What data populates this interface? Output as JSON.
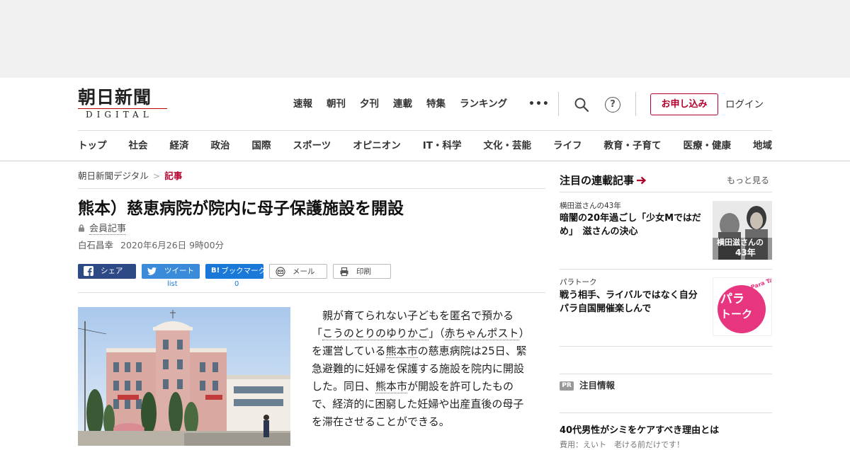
{
  "logo": {
    "kanji": "朝日新聞",
    "digital": "DIGITAL"
  },
  "top_nav": [
    "速報",
    "朝刊",
    "夕刊",
    "連載",
    "特集",
    "ランキング"
  ],
  "more_label": "•••",
  "header_actions": {
    "help": "?",
    "apply": "お申し込み",
    "login": "ログイン"
  },
  "categories": [
    "トップ",
    "社会",
    "経済",
    "政治",
    "国際",
    "スポーツ",
    "オピニオン",
    "IT・科学",
    "文化・芸能",
    "ライフ",
    "教育・子育て",
    "医療・健康",
    "地域"
  ],
  "breadcrumb": {
    "home": "朝日新聞デジタル",
    "sep": ">",
    "current": "記事"
  },
  "article": {
    "title": "熊本）慈恵病院が院内に母子保護施設を開設",
    "member_label": "会員記事",
    "author": "白石昌幸",
    "date": "2020年6月26日 9時00分",
    "body": {
      "p1": "　親が育てられない子どもを匿名で預かる「",
      "link1": "こうのとりのゆりかご",
      "p2": "」（",
      "link2": "赤ちゃんポスト",
      "p3": "）を運営している",
      "link3": "熊本市",
      "p4": "の慈恵病院は25日、緊急避難的に妊婦を保護する施設を院内に開設した。同日、",
      "link4": "熊本市",
      "p5": "が開設を許可したもので、経済的に困窮した妊婦や出産直後の母子を滞在させることができる。"
    }
  },
  "share": {
    "facebook": "シェア",
    "twitter": "ツイート",
    "twitter_count": "list",
    "hatena_icon": "B!",
    "hatena": "ブックマーク",
    "hatena_count": "0",
    "mail": "メール",
    "print": "印刷"
  },
  "sidebar": {
    "heading": "注目の連載記事",
    "more": "もっと見る",
    "items": [
      {
        "kicker": "横田滋さんの43年",
        "title": "暗闇の20年過ごし「少女Mではだめ」　滋さんの決心",
        "thumb_text": "横田滋さんの",
        "thumb_num": "43年"
      },
      {
        "kicker": "パラトーク",
        "title": "戦う相手、ライバルではなく自分　パラ自国開催楽しんで",
        "thumb_text_1": "パラ",
        "thumb_text_2": "トーク",
        "thumb_tag": "Para Talk"
      }
    ],
    "pr": {
      "badge": "PR",
      "label": "注目情報",
      "title": "40代男性がシミをケアすべき理由とは",
      "sub": "費用：えいト　老ける前だけです！"
    }
  },
  "colors": {
    "brand_red": "#b2002c",
    "facebook": "#2d4a86",
    "twitter": "#3a8bd9",
    "hatena": "#1a78d8"
  }
}
